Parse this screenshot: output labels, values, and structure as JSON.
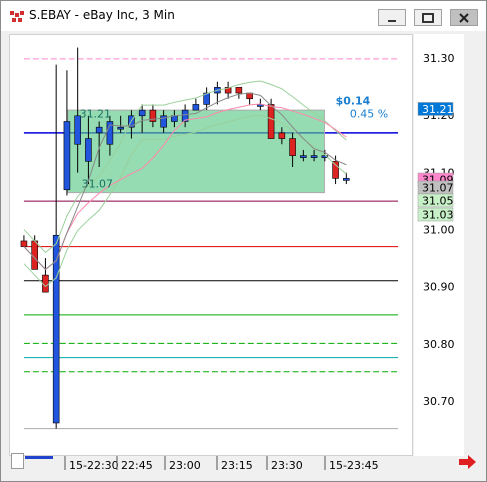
{
  "window": {
    "title": "S.EBAY - eBay Inc, 3 Min",
    "buttons": [
      "minimize",
      "restore",
      "close"
    ]
  },
  "chart_data": {
    "type": "candlestick",
    "symbol": "S.EBAY",
    "interval": "3 Min",
    "price_axis": {
      "ticks": [
        "31.30",
        "31.20",
        "31.10",
        "31.00",
        "30.90",
        "30.80",
        "30.70"
      ],
      "range": [
        30.64,
        31.36
      ]
    },
    "time_axis": {
      "ticks": [
        "15-22:30",
        "22:45",
        "23:00",
        "23:15",
        "23:30",
        "15-23:45"
      ]
    },
    "price_tags": [
      {
        "label": "31.21",
        "color": "#0078d7"
      },
      {
        "label": "31.09",
        "color": "#ff88cc"
      },
      {
        "label": "31.07",
        "color": "#c0c0c0"
      },
      {
        "label": "31.05",
        "color": "#c8f0c8"
      },
      {
        "label": "31.03",
        "color": "#c8f0c8"
      }
    ],
    "annotations": {
      "change": "$0.14",
      "change_pct": "0.45 %",
      "box_high": "31.21",
      "box_low": "31.07"
    },
    "candles": [
      {
        "o": 30.98,
        "h": 30.99,
        "l": 30.97,
        "c": 30.97
      },
      {
        "o": 30.98,
        "h": 30.99,
        "l": 30.93,
        "c": 30.93
      },
      {
        "o": 30.92,
        "h": 30.95,
        "l": 30.89,
        "c": 30.89
      },
      {
        "o": 30.66,
        "h": 31.29,
        "l": 30.65,
        "c": 30.99
      },
      {
        "o": 31.07,
        "h": 31.28,
        "l": 31.06,
        "c": 31.19
      },
      {
        "o": 31.15,
        "h": 31.32,
        "l": 31.1,
        "c": 31.2
      },
      {
        "o": 31.12,
        "h": 31.2,
        "l": 31.08,
        "c": 31.16
      },
      {
        "o": 31.17,
        "h": 31.19,
        "l": 31.11,
        "c": 31.18
      },
      {
        "o": 31.15,
        "h": 31.2,
        "l": 31.13,
        "c": 31.19
      },
      {
        "o": 31.18,
        "h": 31.2,
        "l": 31.17,
        "c": 31.18
      },
      {
        "o": 31.18,
        "h": 31.21,
        "l": 31.16,
        "c": 31.2
      },
      {
        "o": 31.2,
        "h": 31.22,
        "l": 31.17,
        "c": 31.21
      },
      {
        "o": 31.21,
        "h": 31.22,
        "l": 31.18,
        "c": 31.19
      },
      {
        "o": 31.18,
        "h": 31.21,
        "l": 31.17,
        "c": 31.2
      },
      {
        "o": 31.19,
        "h": 31.21,
        "l": 31.18,
        "c": 31.2
      },
      {
        "o": 31.19,
        "h": 31.22,
        "l": 31.18,
        "c": 31.21
      },
      {
        "o": 31.21,
        "h": 31.23,
        "l": 31.21,
        "c": 31.22
      },
      {
        "o": 31.22,
        "h": 31.25,
        "l": 31.21,
        "c": 31.24
      },
      {
        "o": 31.24,
        "h": 31.26,
        "l": 31.22,
        "c": 31.25
      },
      {
        "o": 31.25,
        "h": 31.26,
        "l": 31.23,
        "c": 31.24
      },
      {
        "o": 31.25,
        "h": 31.25,
        "l": 31.23,
        "c": 31.24
      },
      {
        "o": 31.24,
        "h": 31.24,
        "l": 31.22,
        "c": 31.23
      },
      {
        "o": 31.22,
        "h": 31.23,
        "l": 31.21,
        "c": 31.22
      },
      {
        "o": 31.22,
        "h": 31.23,
        "l": 31.16,
        "c": 31.16
      },
      {
        "o": 31.17,
        "h": 31.18,
        "l": 31.15,
        "c": 31.16
      },
      {
        "o": 31.16,
        "h": 31.17,
        "l": 31.11,
        "c": 31.13
      },
      {
        "o": 31.13,
        "h": 31.14,
        "l": 31.12,
        "c": 31.13
      },
      {
        "o": 31.13,
        "h": 31.14,
        "l": 31.12,
        "c": 31.13
      },
      {
        "o": 31.13,
        "h": 31.14,
        "l": 31.12,
        "c": 31.13
      },
      {
        "o": 31.12,
        "h": 31.13,
        "l": 31.08,
        "c": 31.09
      },
      {
        "o": 31.09,
        "h": 31.1,
        "l": 31.08,
        "c": 31.09
      }
    ],
    "horizontal_lines": [
      {
        "price": 31.3,
        "color": "#ff88cc",
        "style": "dashed"
      },
      {
        "price": 31.17,
        "color": "#0000dd",
        "style": "solid"
      },
      {
        "price": 31.05,
        "color": "#880044",
        "style": "solid"
      },
      {
        "price": 30.97,
        "color": "#dd0000",
        "style": "solid"
      },
      {
        "price": 30.91,
        "color": "#000000",
        "style": "solid"
      },
      {
        "price": 30.85,
        "color": "#00aa00",
        "style": "solid"
      },
      {
        "price": 30.8,
        "color": "#00aa00",
        "style": "dashed"
      },
      {
        "price": 30.775,
        "color": "#00aaaa",
        "style": "solid"
      },
      {
        "price": 30.75,
        "color": "#00aa00",
        "style": "dashed"
      },
      {
        "price": 30.65,
        "color": "#aaaaaa",
        "style": "solid"
      }
    ]
  }
}
